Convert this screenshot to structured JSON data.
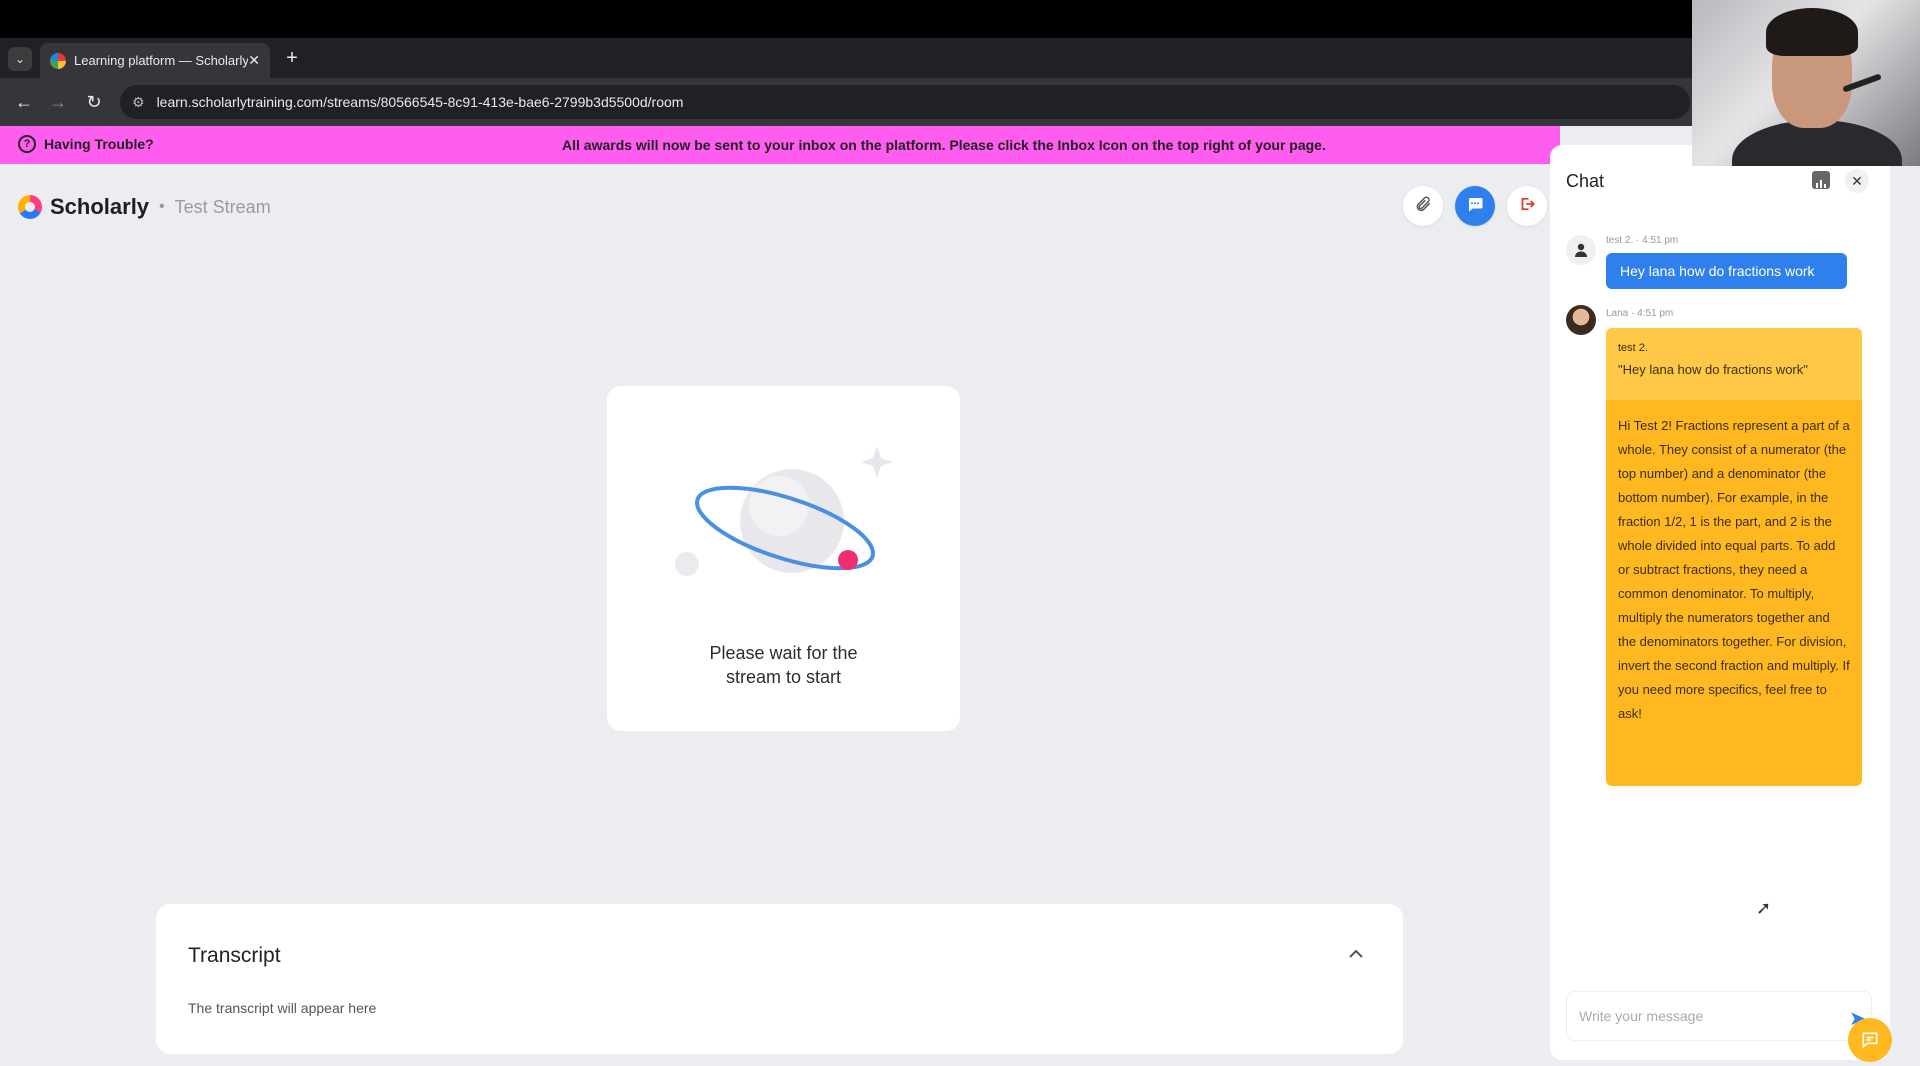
{
  "browser": {
    "tab_title": "Learning platform — Scholarly",
    "url": "learn.scholarlytraining.com/streams/80566545-8c91-413e-bae6-2799b3d5500d/room"
  },
  "banner": {
    "help_label": "Having Trouble?",
    "message": "All awards will now be sent to your inbox on the platform. Please click the Inbox Icon on the top right of your page."
  },
  "header": {
    "brand": "Scholarly",
    "separator": "•",
    "stream_name": "Test Stream"
  },
  "waiting": {
    "message": "Please wait for the stream to start"
  },
  "transcript": {
    "title": "Transcript",
    "empty_text": "The transcript will appear here"
  },
  "chat": {
    "title": "Chat",
    "messages": [
      {
        "meta": "test 2. · 4:51 pm",
        "text": "Hey lana how do fractions work"
      },
      {
        "meta": "Lana · 4:51 pm",
        "quote_name": "test 2.",
        "quote_text": "\"Hey lana how do fractions work\"",
        "text": "Hi Test 2! Fractions represent a part of a whole. They consist of a numerator (the top number) and a denominator (the bottom number). For example, in the fraction 1/2, 1 is the part, and 2 is the whole divided into equal parts. To add or subtract fractions, they need a common denominator. To multiply, multiply the numerators together and the denominators together. For division, invert the second fraction and multiply. If you need more specifics, feel free to ask!"
      }
    ],
    "input_placeholder": "Write your message"
  },
  "icons": {
    "attach": "paperclip-icon",
    "chat": "chat-bubble-icon",
    "leave": "exit-icon"
  },
  "colors": {
    "banner": "#ff5cf0",
    "primary": "#2f80ed",
    "ai_bubble": "#ffb81f"
  }
}
